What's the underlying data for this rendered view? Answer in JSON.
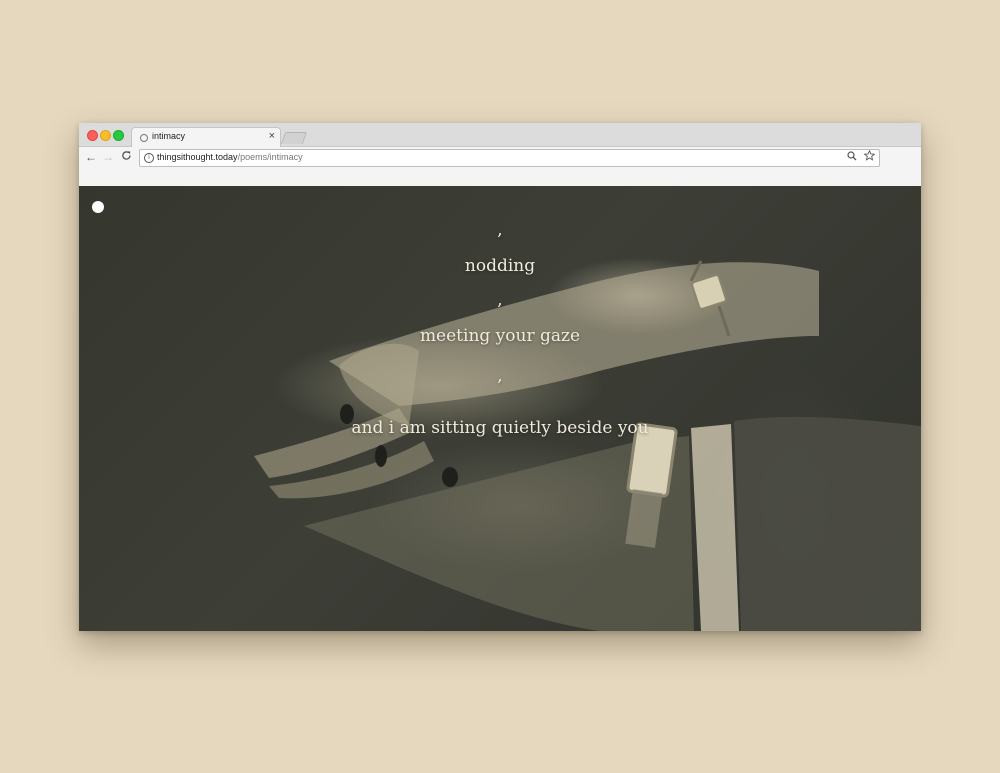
{
  "browser": {
    "tab": {
      "title": "intimacy",
      "close_glyph": "×"
    },
    "nav": {
      "back_glyph": "←",
      "forward_glyph": "→",
      "reload_glyph": "C"
    },
    "address": {
      "domain": "thingsithought.today",
      "path": "/poems/intimacy",
      "info_glyph": "i"
    },
    "icons": {
      "zoom": "zoom-icon",
      "star": "star-icon",
      "favicon": "globe-icon"
    },
    "colors": {
      "close": "#fc5f57",
      "minimize": "#fdbc2e",
      "maximize": "#28c840"
    }
  },
  "page": {
    "background": "#e5d8be",
    "content_bg": "#35372f",
    "text_color": "#f0ebdc",
    "poem": [
      ",",
      "nodding",
      ",",
      "meeting your gaze",
      ",",
      "and i am sitting quietly beside you"
    ]
  }
}
